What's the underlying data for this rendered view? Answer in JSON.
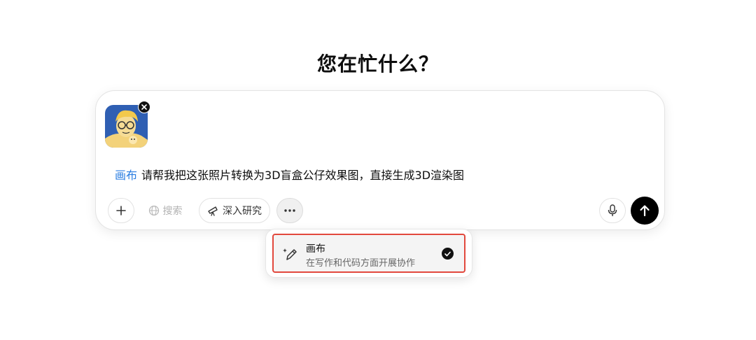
{
  "heading": "您在忙什么？",
  "composer": {
    "attachment": {
      "kind": "image",
      "description_icon": "cartoon-portrait-image"
    },
    "remove_icon": "close-icon",
    "tool_tag": "画布",
    "prompt_text": "请帮我把这张照片转换为3D盲盒公仔效果图，直接生成3D渲染图"
  },
  "toolbar": {
    "add_icon": "plus-icon",
    "search_label": "搜索",
    "search_icon": "globe-icon",
    "research_label": "深入研究",
    "research_icon": "telescope-icon",
    "more_icon": "ellipsis-icon",
    "mic_icon": "microphone-icon",
    "send_icon": "arrow-up-icon"
  },
  "dropdown": {
    "items": [
      {
        "title": "画布",
        "description": "在写作和代码方面开展协作",
        "icon": "pencil-sparkle-icon",
        "selected": true
      }
    ]
  },
  "colors": {
    "tool_tag": "#2a7de1",
    "highlight_border": "#e2483d",
    "send_button": "#000000"
  }
}
